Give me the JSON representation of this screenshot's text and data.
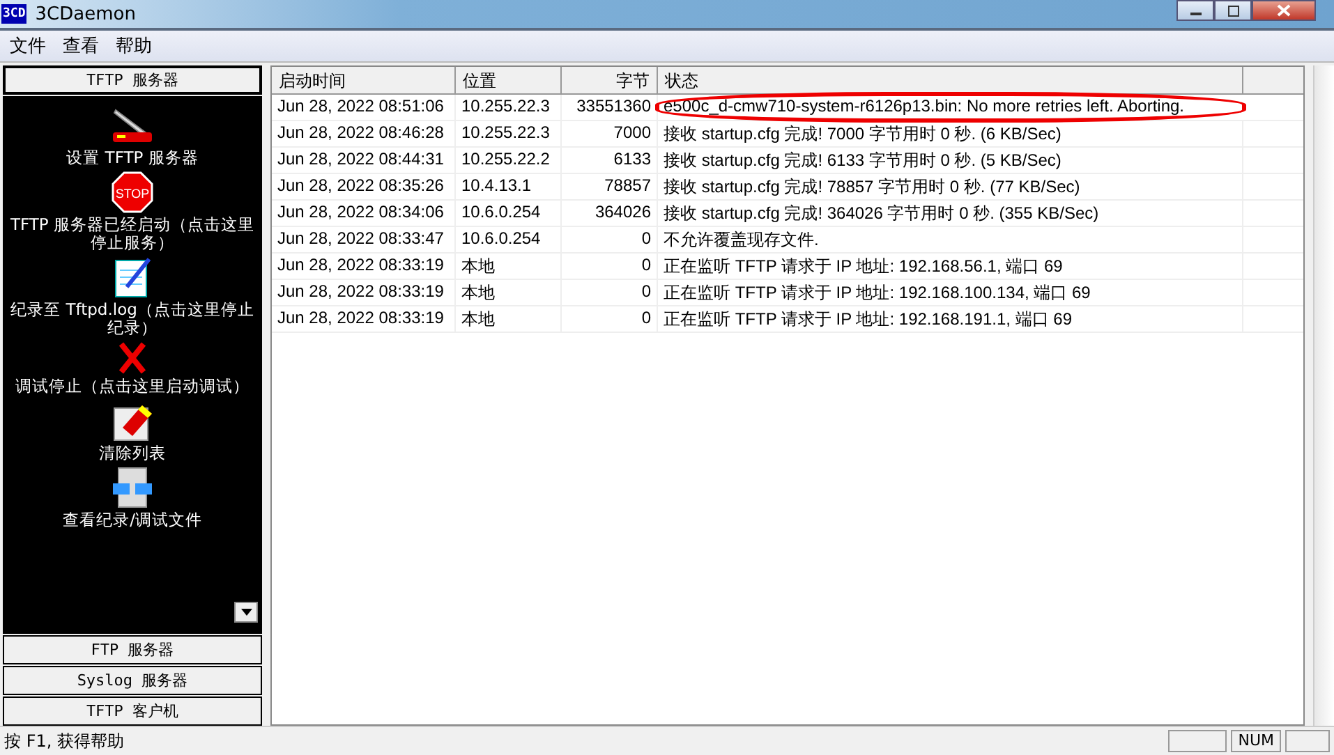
{
  "window": {
    "title": "3CDaemon",
    "logo": "3CD"
  },
  "menu": [
    "文件",
    "查看",
    "帮助"
  ],
  "sidebar": {
    "sections_top": [
      {
        "label": "TFTP 服务器",
        "selected": true
      }
    ],
    "items": [
      {
        "kind": "knife",
        "label": "设置 TFTP 服务器"
      },
      {
        "kind": "stop",
        "label": "TFTP 服务器已经启动（点击这里停止服务）",
        "icon_text": "STOP"
      },
      {
        "kind": "log",
        "label": "纪录至 Tftpd.log（点击这里停止纪录）"
      },
      {
        "kind": "debug",
        "label": "调试停止（点击这里启动调试）"
      },
      {
        "kind": "clear",
        "label": "清除列表"
      },
      {
        "kind": "view",
        "label": "查看纪录/调试文件"
      }
    ],
    "sections_bottom": [
      {
        "label": "FTP 服务器",
        "selected": false
      },
      {
        "label": "Syslog 服务器",
        "selected": false
      },
      {
        "label": "TFTP 客户机",
        "selected": false
      }
    ]
  },
  "table": {
    "columns": [
      "启动时间",
      "位置",
      "字节",
      "状态"
    ],
    "rows": [
      {
        "time": "Jun 28, 2022 08:51:06",
        "location": "10.255.22.3",
        "bytes": "33551360",
        "status": "e500c_d-cmw710-system-r6126p13.bin: No more retries left. Aborting.",
        "circled": true
      },
      {
        "time": "Jun 28, 2022 08:46:28",
        "location": "10.255.22.3",
        "bytes": "7000",
        "status": "接收 startup.cfg 完成! 7000 字节用时 0 秒. (6 KB/Sec)",
        "circled": false
      },
      {
        "time": "Jun 28, 2022 08:44:31",
        "location": "10.255.22.2",
        "bytes": "6133",
        "status": "接收 startup.cfg 完成! 6133 字节用时 0 秒. (5 KB/Sec)",
        "circled": false
      },
      {
        "time": "Jun 28, 2022 08:35:26",
        "location": "10.4.13.1",
        "bytes": "78857",
        "status": "接收 startup.cfg 完成! 78857 字节用时 0 秒. (77 KB/Sec)",
        "circled": false
      },
      {
        "time": "Jun 28, 2022 08:34:06",
        "location": "10.6.0.254",
        "bytes": "364026",
        "status": "接收 startup.cfg 完成! 364026 字节用时 0 秒. (355 KB/Sec)",
        "circled": false
      },
      {
        "time": "Jun 28, 2022 08:33:47",
        "location": "10.6.0.254",
        "bytes": "0",
        "status": "不允许覆盖现存文件.",
        "circled": false
      },
      {
        "time": "Jun 28, 2022 08:33:19",
        "location": "本地",
        "bytes": "0",
        "status": "正在监听 TFTP 请求于 IP 地址: 192.168.56.1, 端口 69",
        "circled": false
      },
      {
        "time": "Jun 28, 2022 08:33:19",
        "location": "本地",
        "bytes": "0",
        "status": "正在监听 TFTP 请求于 IP 地址: 192.168.100.134, 端口 69",
        "circled": false
      },
      {
        "time": "Jun 28, 2022 08:33:19",
        "location": "本地",
        "bytes": "0",
        "status": "正在监听 TFTP 请求于 IP 地址: 192.168.191.1, 端口 69",
        "circled": false
      }
    ]
  },
  "status_bar": {
    "text": "按 F1, 获得帮助",
    "indicator": "NUM"
  }
}
